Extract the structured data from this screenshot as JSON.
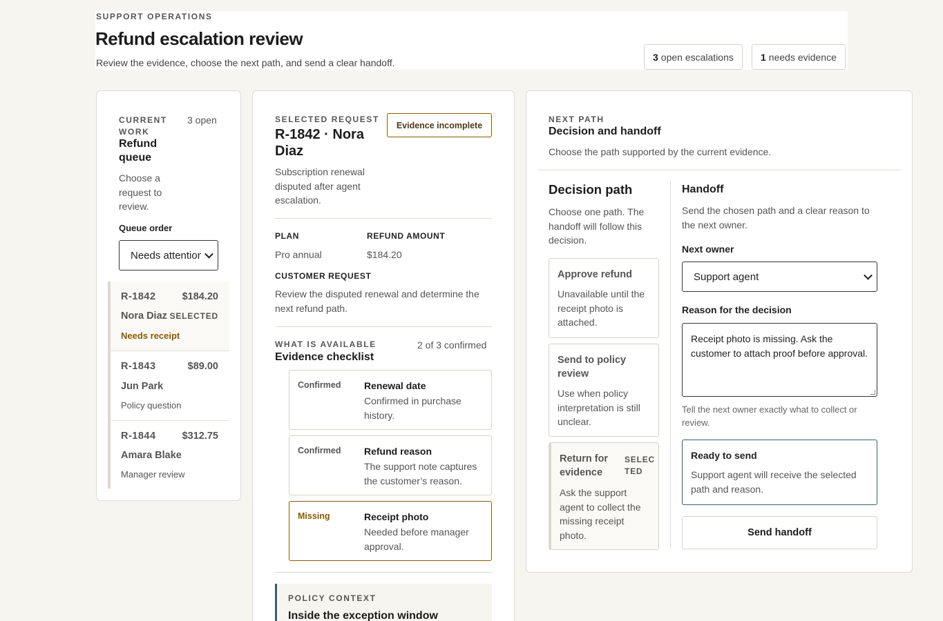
{
  "header": {
    "eyebrow": "SUPPORT OPERATIONS",
    "title": "Refund escalation review",
    "subtitle": "Review the evidence, choose the next path, and send a clear handoff.",
    "open_count": "3",
    "open_label": "open escalations",
    "evidence_count": "1",
    "evidence_label": "needs evidence"
  },
  "queue": {
    "eyebrow_line1": "CURRENT",
    "eyebrow_line2": "WORK",
    "open": "3 open",
    "title_line1": "Refund",
    "title_line2": "queue",
    "desc_line1": "Choose a",
    "desc_line2": "request to",
    "desc_line3": "review.",
    "order_label": "Queue order",
    "order_value": "Needs attention",
    "items": [
      {
        "id": "R-1842",
        "amount": "$184.20",
        "name": "Nora Diaz",
        "tag": "SELECTED",
        "status": "Needs receipt"
      },
      {
        "id": "R-1843",
        "amount": "$89.00",
        "name": "Jun Park",
        "tag": "",
        "status": "Policy question"
      },
      {
        "id": "R-1844",
        "amount": "$312.75",
        "name": "Amara Blake",
        "tag": "",
        "status": "Manager review"
      }
    ]
  },
  "detail": {
    "eyebrow": "SELECTED REQUEST",
    "title_line1": "R-1842 · Nora",
    "title_line2": "Diaz",
    "badge": "Evidence incomplete",
    "desc_line1": "Subscription renewal",
    "desc_line2": "disputed after agent",
    "desc_line3": "escalation.",
    "plan_label": "PLAN",
    "plan_value": "Pro annual",
    "amount_label": "REFUND AMOUNT",
    "amount_value": "$184.20",
    "request_label": "CUSTOMER REQUEST",
    "request_line1": "Review the disputed renewal and determine the",
    "request_line2": "next refund path.",
    "checklist_eyebrow": "WHAT IS AVAILABLE",
    "checklist_title": "Evidence checklist",
    "checklist_count": "2 of 3 confirmed",
    "evidence": [
      {
        "status": "Confirmed",
        "title": "Renewal date",
        "desc_line1": "Confirmed in purchase",
        "desc_line2": "history."
      },
      {
        "status": "Confirmed",
        "title": "Refund reason",
        "desc_line1": "The support note captures",
        "desc_line2": "the customer’s reason."
      },
      {
        "status": "Missing",
        "title": "Receipt photo",
        "desc_line1": "Needed before manager",
        "desc_line2": "approval."
      }
    ],
    "policy_eyebrow": "POLICY CONTEXT",
    "policy_title": "Inside the exception window"
  },
  "path": {
    "eyebrow": "NEXT PATH",
    "title": "Decision and handoff",
    "subtitle": "Choose the path supported by the current evidence.",
    "decision_title": "Decision path",
    "decision_desc_line1": "Choose one path. The",
    "decision_desc_line2": "handoff will follow this",
    "decision_desc_line3": "decision.",
    "options": [
      {
        "title_line1": "Approve refund",
        "title_line2": "",
        "tag_line1": "",
        "tag_line2": "",
        "desc_line1": "Unavailable until the",
        "desc_line2": "receipt photo is",
        "desc_line3": "attached.",
        "desc_line4": ""
      },
      {
        "title_line1": "Send to policy",
        "title_line2": "review",
        "tag_line1": "",
        "tag_line2": "",
        "desc_line1": "Use when policy",
        "desc_line2": "interpretation is still",
        "desc_line3": "unclear.",
        "desc_line4": ""
      },
      {
        "title_line1": "Return for",
        "title_line2": "evidence",
        "tag_line1": "SELEC",
        "tag_line2": "TED",
        "desc_line1": "Ask the support",
        "desc_line2": "agent to collect the",
        "desc_line3": "missing receipt",
        "desc_line4": "photo."
      }
    ],
    "handoff_title": "Handoff",
    "handoff_desc_line1": "Send the chosen path and a clear reason to",
    "handoff_desc_line2": "the next owner.",
    "owner_label": "Next owner",
    "owner_value": "Support agent",
    "reason_label": "Reason for the decision",
    "reason_value": "Receipt photo is missing. Ask the customer to attach proof before approval.",
    "reason_hint_line1": "Tell the next owner exactly what to collect or",
    "reason_hint_line2": "review.",
    "ready_title": "Ready to send",
    "ready_desc_line1": "Support agent will receive the selected",
    "ready_desc_line2": "path and reason.",
    "send_label": "Send handoff"
  }
}
